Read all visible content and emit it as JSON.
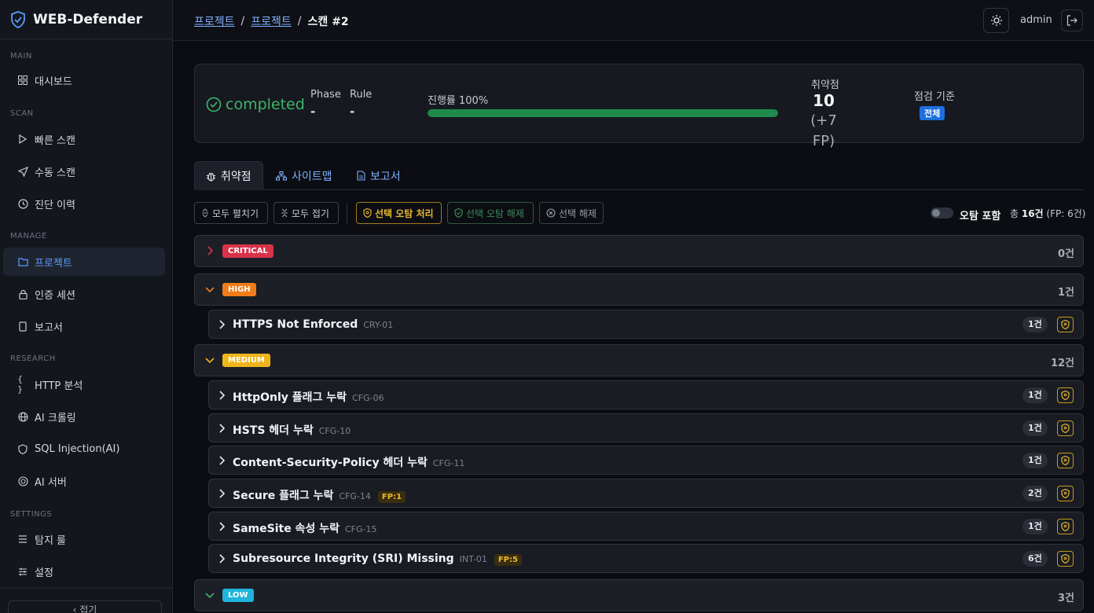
{
  "brand": {
    "name": "WEB-Defender"
  },
  "sidebar": {
    "sections": {
      "main": "MAIN",
      "scan": "SCAN",
      "manage": "MANAGE",
      "research": "RESEARCH",
      "settings": "SETTINGS"
    },
    "items": {
      "dashboard": "대시보드",
      "quick_scan": "빠른 스캔",
      "manual_scan": "수동 스캔",
      "history": "진단 이력",
      "projects": "프로젝트",
      "auth_session": "인증 세션",
      "reports": "보고서",
      "http_analysis": "HTTP 분석",
      "ai_crawling": "AI 크롤링",
      "sql_injection": "SQL Injection(AI)",
      "ai_server": "AI 서버",
      "detect_rules": "탐지 룰",
      "settings": "설정"
    },
    "collapse_label": "‹ 접기"
  },
  "header": {
    "breadcrumb": [
      "프로젝트",
      "프로젝트",
      "스캔 #2"
    ],
    "user": "admin"
  },
  "status": {
    "state": "completed",
    "phase_label": "Phase",
    "phase_value": "-",
    "rule_label": "Rule",
    "rule_value": "-",
    "progress_label": "진행률 100%",
    "progress_pct": 100,
    "vuln_label": "취약점",
    "vuln_count": "10",
    "vuln_fp": "(+7 FP)",
    "standard_label": "점검 기준",
    "standard_value": "전체"
  },
  "tabs": {
    "vulns": "취약점",
    "sitemap": "사이트맵",
    "report": "보고서"
  },
  "toolbar": {
    "expand_all": "모두 펼치기",
    "collapse_all": "모두 접기",
    "mark_fp": "선택 오탐 처리",
    "unmark_fp": "선택 오탐 해제",
    "deselect": "선택 해제",
    "include_fp": "오탐 포함",
    "total_prefix": "총 ",
    "total_num": "16건",
    "total_suffix": " (FP: 6건)"
  },
  "severities": {
    "critical": {
      "label": "CRITICAL",
      "count": "0건",
      "color": "#d8334a"
    },
    "high": {
      "label": "HIGH",
      "count": "1건",
      "color": "#f07c1a"
    },
    "medium": {
      "label": "MEDIUM",
      "count": "12건",
      "color": "#f0b51a"
    },
    "low": {
      "label": "LOW",
      "count": "3건",
      "color": "#1eb4dc"
    }
  },
  "findings": {
    "high": [
      {
        "name": "HTTPS Not Enforced",
        "code": "CRY-01",
        "count": "1건"
      }
    ],
    "medium": [
      {
        "name": "HttpOnly 플래그 누락",
        "code": "CFG-06",
        "count": "1건"
      },
      {
        "name": "HSTS 헤더 누락",
        "code": "CFG-10",
        "count": "1건"
      },
      {
        "name": "Content-Security-Policy 헤더 누락",
        "code": "CFG-11",
        "count": "1건"
      },
      {
        "name": "Secure 플래그 누락",
        "code": "CFG-14",
        "fp": "FP:1",
        "count": "2건"
      },
      {
        "name": "SameSite 속성 누락",
        "code": "CFG-15",
        "count": "1건"
      },
      {
        "name": "Subresource Integrity (SRI) Missing",
        "code": "INT-01",
        "fp": "FP:5",
        "count": "6건"
      }
    ]
  },
  "colors": {
    "accent": "#5b9cff",
    "success": "#3fb56a",
    "warn": "#e8b830"
  }
}
